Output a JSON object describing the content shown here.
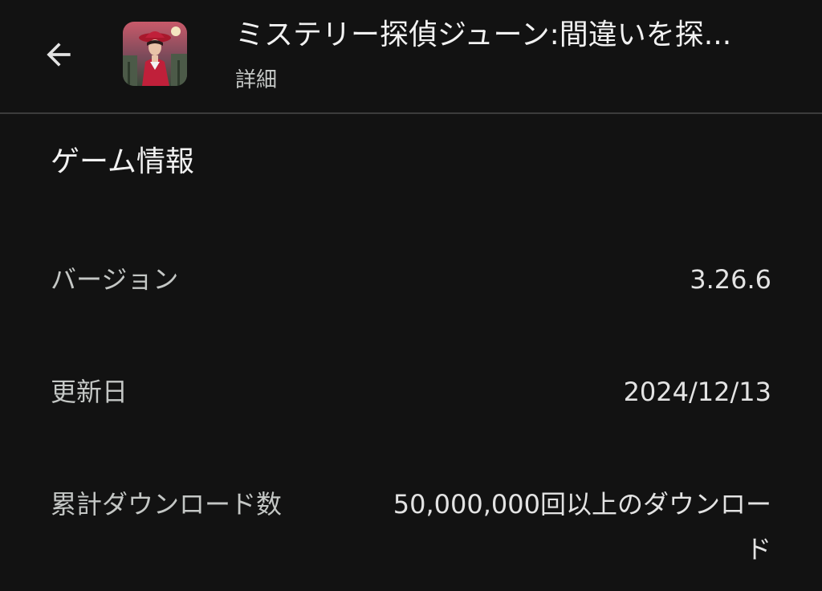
{
  "header": {
    "back_icon": "arrow-left-icon",
    "app_icon": "app-icon-detective-june",
    "title": "ミステリー探偵ジューン:間違いを探...",
    "subtitle": "詳細"
  },
  "section": {
    "title": "ゲーム情報"
  },
  "rows": [
    {
      "label": "バージョン",
      "value": "3.26.6"
    },
    {
      "label": "更新日",
      "value": "2024/12/13"
    },
    {
      "label": "累計ダウンロード数",
      "value": "50,000,000回以上のダウンロード"
    }
  ],
  "colors": {
    "background": "#121212",
    "divider": "#3c3c3c",
    "text_primary": "#f1f1f1",
    "text_secondary": "#c4c7c5"
  }
}
